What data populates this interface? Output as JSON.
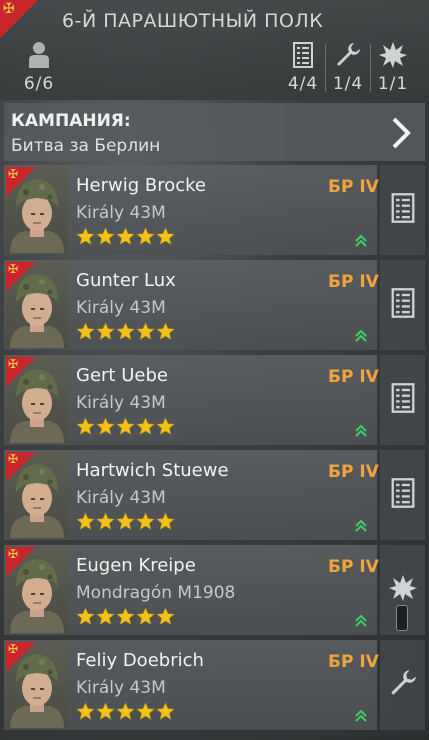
{
  "squad": {
    "title": "6-Й ПАРАШЮТНЫЙ ПОЛК",
    "stats": {
      "soldiers": "6/6",
      "riflemen": "4/4",
      "engineers": "1/4",
      "assault": "1/1"
    },
    "icons": [
      "squad-cross-icon",
      "person-icon",
      "clipboard-icon",
      "wrench-icon",
      "explosion-icon"
    ]
  },
  "campaign": {
    "label": "КАМПАНИЯ:",
    "value": "Битва за Берлин"
  },
  "soldiers": [
    {
      "name": "Herwig Brocke",
      "weapon": "Király 43M",
      "rank": "БР IV",
      "stars": 5,
      "role_icon": "clipboard-icon"
    },
    {
      "name": "Gunter Lux",
      "weapon": "Király 43M",
      "rank": "БР IV",
      "stars": 5,
      "role_icon": "clipboard-icon"
    },
    {
      "name": "Gert Uebe",
      "weapon": "Király 43M",
      "rank": "БР IV",
      "stars": 5,
      "role_icon": "clipboard-icon"
    },
    {
      "name": "Hartwich Stuewe",
      "weapon": "Király 43M",
      "rank": "БР IV",
      "stars": 5,
      "role_icon": "clipboard-icon"
    },
    {
      "name": "Eugen Kreipe",
      "weapon": "Mondragón M1908",
      "rank": "БР IV",
      "stars": 5,
      "role_icon": "explosion-icon"
    },
    {
      "name": "Feliy Doebrich",
      "weapon": "Király 43M",
      "rank": "БР IV",
      "stars": 5,
      "role_icon": "wrench-icon"
    }
  ],
  "colors": {
    "rank": "#f0a43c",
    "star": "#f2c21b",
    "flag": "#c8262a",
    "chevron": "#3ecf6a"
  }
}
